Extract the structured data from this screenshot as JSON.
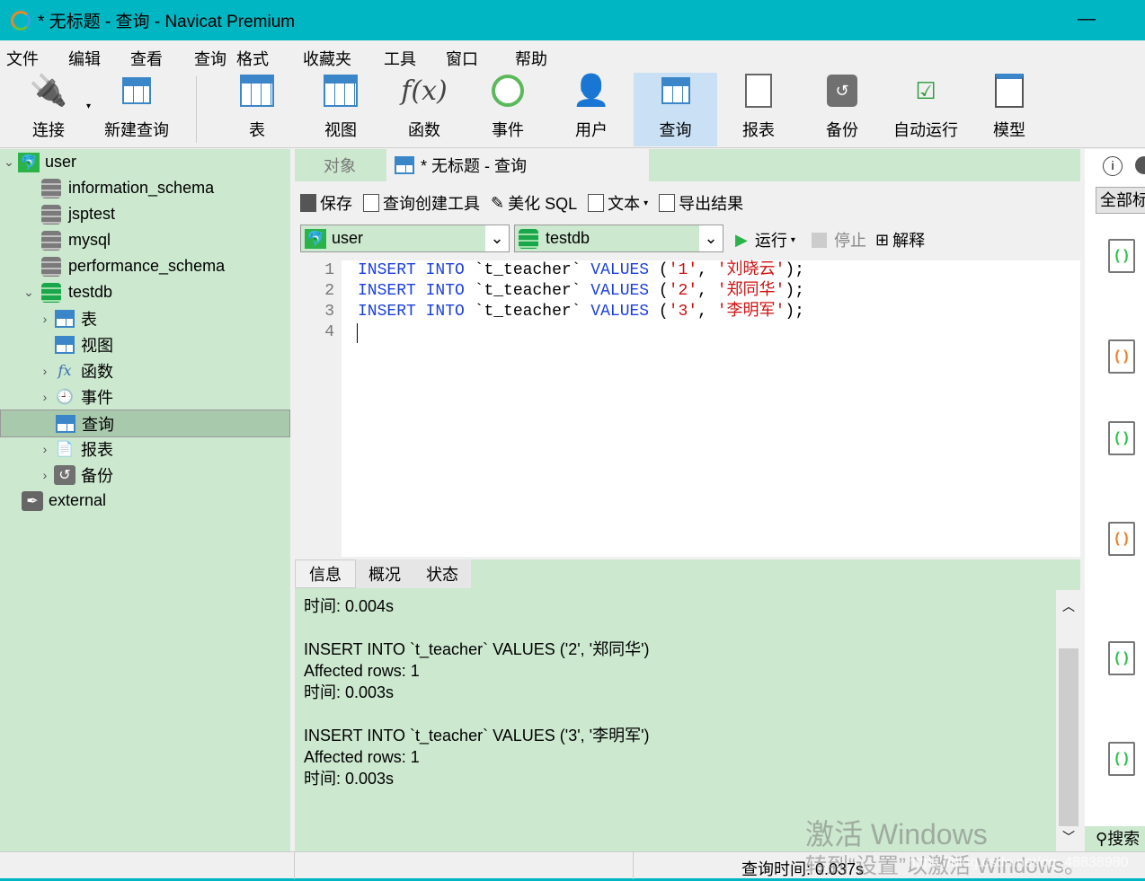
{
  "window": {
    "title": "* 无标题 - 查询 - Navicat Premium",
    "minimize": "—"
  },
  "menu": [
    "文件",
    "编辑",
    "查看",
    "查询",
    "格式",
    "收藏夹",
    "工具",
    "窗口",
    "帮助"
  ],
  "toolbar": [
    {
      "label": "连接",
      "icon": "plug-add-icon"
    },
    {
      "label": "新建查询",
      "icon": "new-query-icon"
    },
    {
      "label": "表",
      "icon": "table-icon"
    },
    {
      "label": "视图",
      "icon": "view-icon"
    },
    {
      "label": "函数",
      "icon": "function-icon"
    },
    {
      "label": "事件",
      "icon": "clock-icon"
    },
    {
      "label": "用户",
      "icon": "user-icon"
    },
    {
      "label": "查询",
      "icon": "query-icon",
      "active": true
    },
    {
      "label": "报表",
      "icon": "report-icon"
    },
    {
      "label": "备份",
      "icon": "backup-icon"
    },
    {
      "label": "自动运行",
      "icon": "schedule-icon"
    },
    {
      "label": "模型",
      "icon": "model-icon"
    }
  ],
  "tree": {
    "connection": "user",
    "databases": [
      "information_schema",
      "jsptest",
      "mysql",
      "performance_schema",
      "testdb"
    ],
    "testdb_children": [
      "表",
      "视图",
      "函数",
      "事件",
      "查询",
      "报表",
      "备份"
    ],
    "other": "external"
  },
  "tabs": {
    "objects": "对象",
    "query": "* 无标题 - 查询"
  },
  "query_toolbar": {
    "save": "保存",
    "builder": "查询创建工具",
    "beautify": "美化 SQL",
    "text": "文本",
    "export": "导出结果",
    "run": "运行",
    "stop": "停止",
    "explain": "解释"
  },
  "selectors": {
    "connection": "user",
    "database": "testdb"
  },
  "editor": {
    "lines": [
      "1",
      "2",
      "3",
      "4"
    ],
    "code": [
      [
        "INSERT",
        "INTO",
        "`t_teacher`",
        "VALUES",
        "'1'",
        "'刘晓云'"
      ],
      [
        "INSERT",
        "INTO",
        "`t_teacher`",
        "VALUES",
        "'2'",
        "'郑同华'"
      ],
      [
        "INSERT",
        "INTO",
        "`t_teacher`",
        "VALUES",
        "'3'",
        "'李明军'"
      ]
    ]
  },
  "result_tabs": [
    "信息",
    "概况",
    "状态"
  ],
  "messages": [
    "时间: 0.004s",
    "",
    "INSERT INTO `t_teacher` VALUES ('2', '郑同华')",
    "Affected rows: 1",
    "时间: 0.003s",
    "",
    "INSERT INTO `t_teacher` VALUES ('3', '李明军')",
    "Affected rows: 1",
    "时间: 0.003s"
  ],
  "right_panel": {
    "filter": "全部标",
    "search": "搜索"
  },
  "status": {
    "query_time": "查询时间: 0.037s"
  },
  "watermark": {
    "line1": "激活 Windows",
    "line2": "转到“设置”以激活 Windows。",
    "url": "https://blog.csdn.net/qq_48838980"
  },
  "colors": {
    "titlebar": "#00b6c2",
    "panel": "#cce8cf",
    "selected": "#a9c9ad",
    "keyword": "#1a3fe0",
    "string": "#d01010"
  }
}
